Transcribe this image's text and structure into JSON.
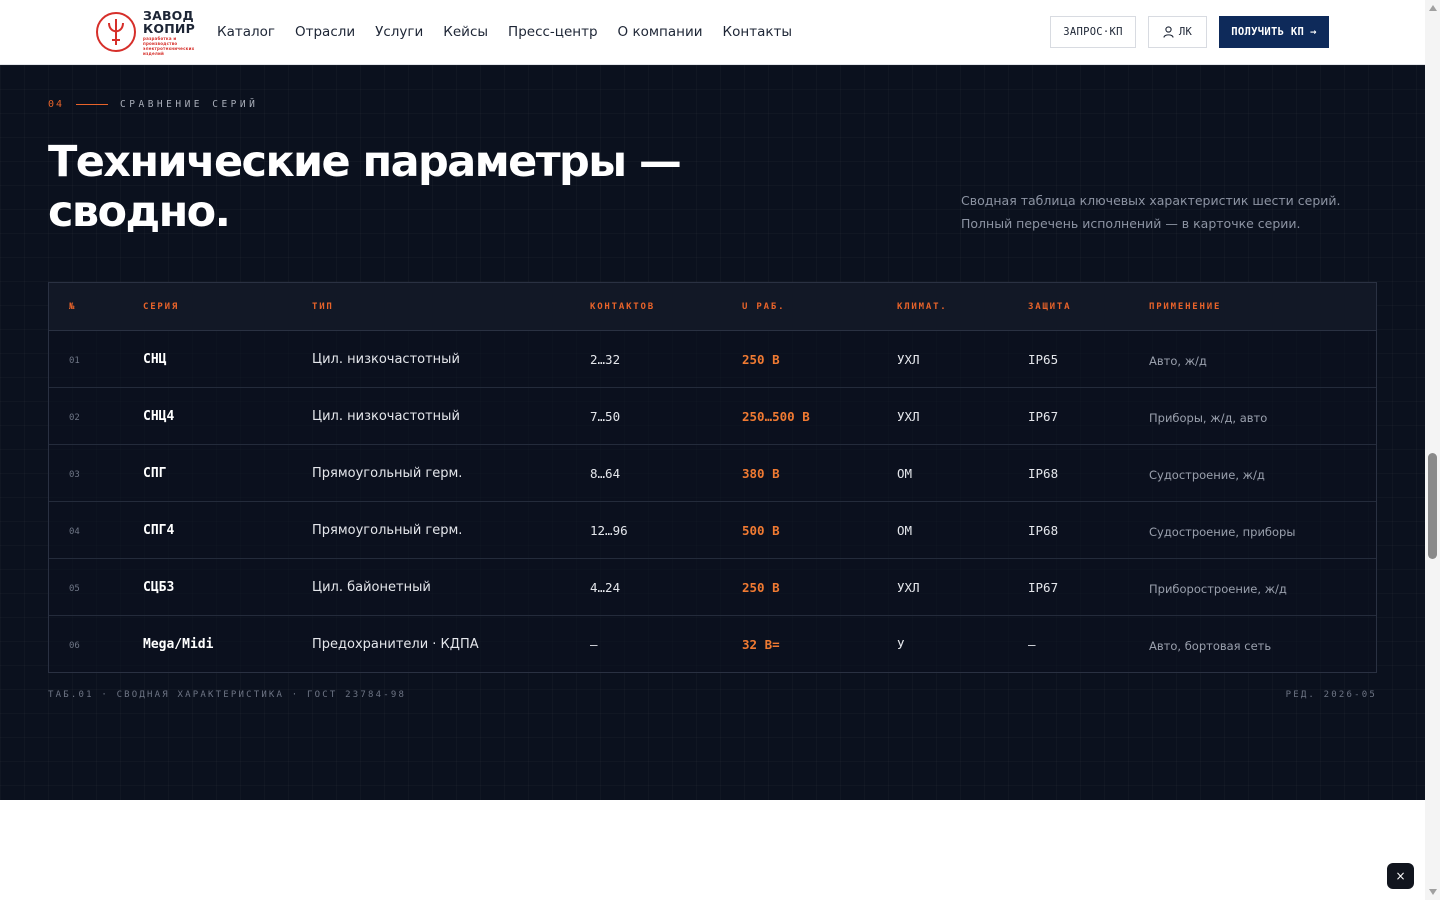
{
  "brand": {
    "name_line1": "ЗАВОД",
    "name_line2": "КОПИР",
    "tagline": "разработка и производство электротехнических изделий",
    "accent": "#d62f2a"
  },
  "nav": {
    "items": [
      "Каталог",
      "Отрасли",
      "Услуги",
      "Кейсы",
      "Пресс-центр",
      "О компании",
      "Контакты"
    ]
  },
  "header_actions": {
    "request_label": "ЗАПРОС·КП",
    "lk_label": "ЛК",
    "get_label": "ПОЛУЧИТЬ КП",
    "get_arrow": "→",
    "primary_color": "#0e2a5a"
  },
  "section": {
    "eyebrow_num": "04",
    "eyebrow_text": "СРАВНЕНИЕ СЕРИЙ",
    "title_line1": "Технические параметры —",
    "title_line2": "сводно.",
    "lead": "Сводная таблица ключевых характеристик шести серий. Полный перечень исполнений — в карточке серии.",
    "accent": "#e8632a",
    "background": "#0b111e"
  },
  "table": {
    "headers": [
      "№",
      "СЕРИЯ",
      "ТИП",
      "КОНТАКТОВ",
      "U РАБ.",
      "КЛИМАТ.",
      "ЗАЩИТА",
      "ПРИМЕНЕНИЕ"
    ],
    "rows": [
      {
        "num": "01",
        "series": "СНЦ",
        "type": "Цил. низкочастотный",
        "contacts": "2…32",
        "voltage": "250 В",
        "climate": "УХЛ",
        "protection": "IP65",
        "application": "Авто, ж/д"
      },
      {
        "num": "02",
        "series": "СНЦ4",
        "type": "Цил. низкочастотный",
        "contacts": "7…50",
        "voltage": "250…500 В",
        "climate": "УХЛ",
        "protection": "IP67",
        "application": "Приборы, ж/д, авто"
      },
      {
        "num": "03",
        "series": "СПГ",
        "type": "Прямоугольный герм.",
        "contacts": "8…64",
        "voltage": "380 В",
        "climate": "ОМ",
        "protection": "IP68",
        "application": "Судостроение, ж/д"
      },
      {
        "num": "04",
        "series": "СПГ4",
        "type": "Прямоугольный герм.",
        "contacts": "12…96",
        "voltage": "500 В",
        "climate": "ОМ",
        "protection": "IP68",
        "application": "Судостроение, приборы"
      },
      {
        "num": "05",
        "series": "СЦБ3",
        "type": "Цил. байонетный",
        "contacts": "4…24",
        "voltage": "250 В",
        "climate": "УХЛ",
        "protection": "IP67",
        "application": "Приборостроение, ж/д"
      },
      {
        "num": "06",
        "series": "Mega/Midi",
        "type": "Предохранители · КДПА",
        "contacts": "—",
        "voltage": "32 В=",
        "climate": "У",
        "protection": "—",
        "application": "Авто, бортовая сеть"
      }
    ],
    "caption_left": "ТАБ.01 · СВОДНАЯ ХАРАКТЕРИСТИКА · ГОСТ 23784-98",
    "caption_right": "РЕД. 2026-05"
  },
  "widgets": {
    "close_glyph": "×"
  }
}
